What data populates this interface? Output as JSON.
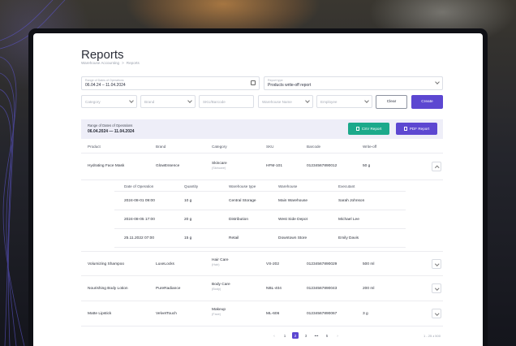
{
  "page": {
    "title": "Reports",
    "breadcrumbs": [
      "Warehouse Accounting",
      ">",
      "Reports"
    ]
  },
  "filters": {
    "date_range": {
      "label": "Range of Dates of Operations",
      "value": "06.04.24 – 11.04.2024"
    },
    "report_type": {
      "label": "Report type",
      "value": "Products write-off report"
    },
    "category_placeholder": "Category",
    "brand_placeholder": "Brand",
    "sku_placeholder": "SKU/Barcode",
    "warehouse_placeholder": "Warehouse Name",
    "employee_placeholder": "Employee",
    "clear_label": "Clear",
    "create_label": "Create"
  },
  "summary": {
    "label": "Range of Dates of Operations",
    "value": "06.04.2024 — 11.04.2024",
    "csv_label": "CSV Report",
    "pdf_label": "PDF Report"
  },
  "table": {
    "columns": [
      "Product",
      "Brand",
      "Category",
      "SKU",
      "Barcode",
      "Write-off"
    ],
    "rows": [
      {
        "product": "Hydrating Face Mask",
        "brand": "GlowEssence",
        "category": "Skincare",
        "subcategory": "(Skincare)",
        "sku": "HFM-101",
        "barcode": "01234567890012",
        "writeoff": "50 g"
      },
      {
        "product": "Volumizing Shampoo",
        "brand": "LuxeLocks",
        "category": "Hair Care",
        "subcategory": "(Hair)",
        "sku": "VS-202",
        "barcode": "01234567890029",
        "writeoff": "500 ml"
      },
      {
        "product": "Nourishing Body Lotion",
        "brand": "PureRadiance",
        "category": "Body Care",
        "subcategory": "(Body)",
        "sku": "NBL-404",
        "barcode": "01234567890043",
        "writeoff": "200 ml"
      },
      {
        "product": "Matte Lipstick",
        "brand": "VelvetTouch",
        "category": "Makeup",
        "subcategory": "(Face)",
        "sku": "ML-606",
        "barcode": "01234567890067",
        "writeoff": "3 g"
      }
    ]
  },
  "details": {
    "columns": [
      "Date of Operation",
      "Quantity",
      "Warehouse type",
      "Warehouse",
      "Executant"
    ],
    "rows": [
      {
        "date": "2024-08-01 09:00",
        "qty": "10 g",
        "type": "Central Storage",
        "warehouse": "Main Warehouse",
        "executant": "Sarah Johnson"
      },
      {
        "date": "2024-08-05 17:00",
        "qty": "20 g",
        "type": "Distribution",
        "warehouse": "West Side Depot",
        "executant": "Michael Lee"
      },
      {
        "date": "25.11.2022 07:00",
        "qty": "15 g",
        "type": "Retail",
        "warehouse": "Downtown Store",
        "executant": "Emily Davis"
      }
    ]
  },
  "pagination": {
    "prev": "‹",
    "pages": [
      "1",
      "2",
      "3",
      "•••",
      "5"
    ],
    "active_page": "2",
    "next": "›",
    "range_text": "1 - 25 з 500"
  },
  "colors": {
    "accent": "#5c47d1",
    "csv": "#1ca98b",
    "summary_bg": "#eeeef8"
  }
}
